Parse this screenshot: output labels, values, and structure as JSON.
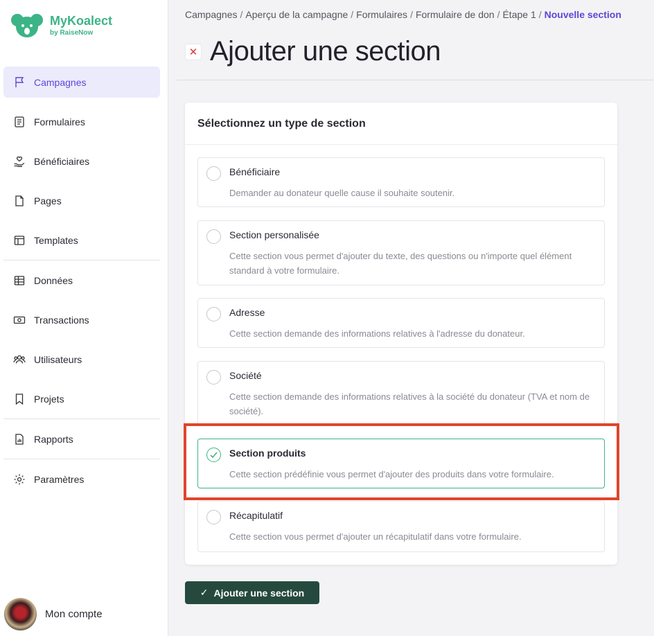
{
  "brand": {
    "title": "MyKoalect",
    "subtitle": "by RaiseNow",
    "color": "#3cb487"
  },
  "sidebar": {
    "items": [
      {
        "label": "Campagnes",
        "icon": "flag-icon",
        "active": true
      },
      {
        "label": "Formulaires",
        "icon": "form-icon"
      },
      {
        "label": "Bénéficiaires",
        "icon": "hand-heart-icon"
      },
      {
        "label": "Pages",
        "icon": "page-icon"
      },
      {
        "label": "Templates",
        "icon": "template-icon"
      },
      {
        "label": "Données",
        "icon": "table-icon"
      },
      {
        "label": "Transactions",
        "icon": "cash-icon"
      },
      {
        "label": "Utilisateurs",
        "icon": "users-icon"
      },
      {
        "label": "Projets",
        "icon": "bookmark-icon"
      },
      {
        "label": "Rapports",
        "icon": "report-icon"
      },
      {
        "label": "Paramètres",
        "icon": "gear-icon"
      }
    ],
    "account_label": "Mon compte"
  },
  "breadcrumb": [
    "Campagnes",
    "Aperçu de la campagne",
    "Formulaires",
    "Formulaire de don",
    "Étape 1",
    "Nouvelle section"
  ],
  "page": {
    "title": "Ajouter une section",
    "close_icon": "close-icon"
  },
  "card": {
    "title": "Sélectionnez un type de section",
    "options": [
      {
        "title": "Bénéficiaire",
        "desc": "Demander au donateur quelle cause il souhaite soutenir.",
        "selected": false
      },
      {
        "title": "Section personalisée",
        "desc": "Cette section vous permet d'ajouter du texte, des questions ou n'importe quel élément standard à votre formulaire.",
        "selected": false
      },
      {
        "title": "Adresse",
        "desc": "Cette section demande des informations relatives à l'adresse du donateur.",
        "selected": false
      },
      {
        "title": "Société",
        "desc": "Cette section demande des informations relatives à la société du donateur (TVA et nom de société).",
        "selected": false
      },
      {
        "title": "Section produits",
        "desc": "Cette section prédéfinie vous permet d'ajouter des produits dans votre formulaire.",
        "selected": true
      },
      {
        "title": "Récapitulatif",
        "desc": "Cette section vous permet d'ajouter un récapitulatif dans votre formulaire.",
        "selected": false
      }
    ]
  },
  "actions": {
    "add_label": "Ajouter une section",
    "check_glyph": "✓"
  },
  "colors": {
    "accent": "#5b47d6",
    "success": "#3cb487",
    "primary_button": "#254a3d",
    "highlight": "#e0452b"
  }
}
